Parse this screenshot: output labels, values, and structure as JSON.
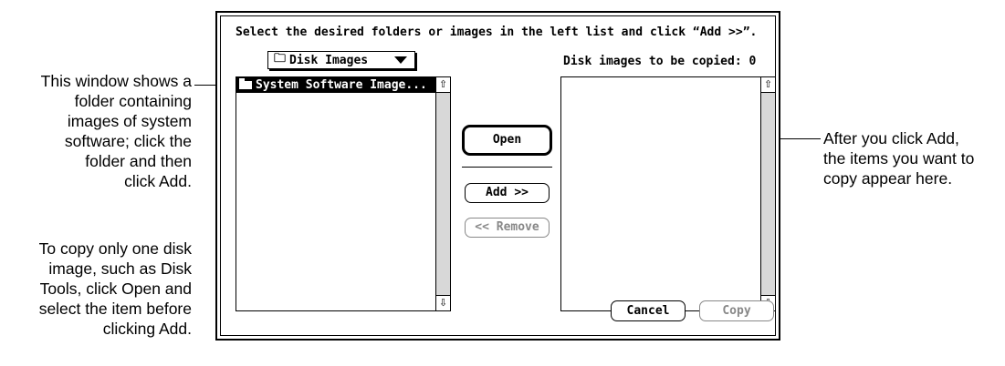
{
  "callouts": {
    "left_top": [
      "This window shows a",
      "folder containing",
      "images of system",
      "software; click the",
      "folder and then",
      "click Add."
    ],
    "left_bottom": [
      "To copy only one disk",
      "image, such as Disk",
      "Tools, click Open and",
      "select the item before",
      "clicking Add."
    ],
    "right": [
      "After you click Add,",
      "the items you want to",
      "copy appear here."
    ]
  },
  "dialog": {
    "instruction": "Select the desired folders or images in the left list and click “Add >>”.",
    "popup_label": "Disk Images",
    "count_label": "Disk images to be copied: 0",
    "left_list": [
      "System Software Image..."
    ],
    "buttons": {
      "open": "Open",
      "add": "Add >>",
      "remove": "<< Remove",
      "cancel": "Cancel",
      "copy": "Copy"
    }
  },
  "icons": [
    "folder-icon",
    "popup-triangle-icon",
    "scroll-up-icon",
    "scroll-down-icon"
  ]
}
